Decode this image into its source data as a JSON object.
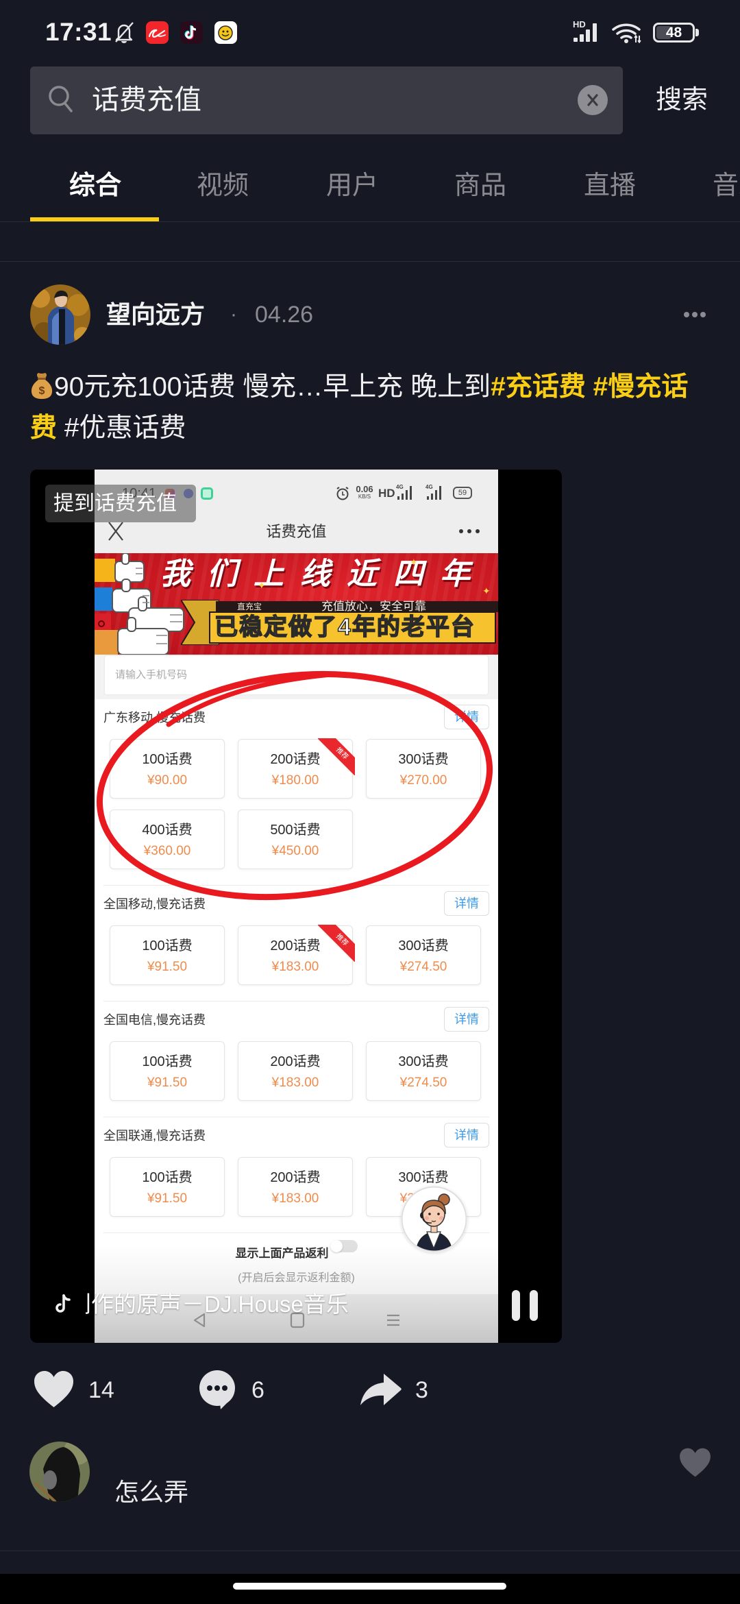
{
  "status_bar": {
    "time": "17:31",
    "network_badge": "HD",
    "battery": "48",
    "battery_percent": 48,
    "notification_icons": [
      "bell-off",
      "alibaba-app",
      "douyin-app",
      "smiley-app"
    ]
  },
  "search": {
    "query": "话费充值",
    "submit_label": "搜索"
  },
  "tabs": [
    {
      "label": "综合",
      "active": true
    },
    {
      "label": "视频",
      "active": false
    },
    {
      "label": "用户",
      "active": false
    },
    {
      "label": "商品",
      "active": false
    },
    {
      "label": "直播",
      "active": false
    },
    {
      "label": "音乐",
      "active": false
    }
  ],
  "post": {
    "author": "望向远方",
    "separator": "·",
    "date": "04.26",
    "caption": {
      "emoji": "money-bag",
      "text": "90元充100话费 慢充…早上充 晚上到",
      "hashtags": [
        {
          "label": "#充话费",
          "highlighted": true
        },
        {
          "label": "#慢充话费",
          "highlighted": true
        },
        {
          "label": "#优惠话费",
          "highlighted": false
        }
      ]
    },
    "video": {
      "tag_label": "提到话费充值",
      "music": "创作的原声－DJ.House音乐",
      "state": "playing",
      "screen": {
        "status_time": "10:41",
        "status_speed": "0.06",
        "status_speed_unit": "KB/S",
        "status_hd": "HD",
        "status_net": "4G",
        "status_battery": "59",
        "title": "话费充值",
        "banner": {
          "headline": "我们上线近四年",
          "brand": "直充宝",
          "slogan": "充值放心，安全可靠",
          "tagline": "已稳定做了4年的老平台"
        },
        "phone_placeholder": "请输入手机号码",
        "detail_label": "详情",
        "sections": [
          {
            "title": "广东移动,慢充话费",
            "items": [
              {
                "name": "100话费",
                "price": "¥90.00"
              },
              {
                "name": "200话费",
                "price": "¥180.00",
                "badge": "推荐"
              },
              {
                "name": "300话费",
                "price": "¥270.00"
              },
              {
                "name": "400话费",
                "price": "¥360.00"
              },
              {
                "name": "500话费",
                "price": "¥450.00"
              }
            ]
          },
          {
            "title": "全国移动,慢充话费",
            "items": [
              {
                "name": "100话费",
                "price": "¥91.50"
              },
              {
                "name": "200话费",
                "price": "¥183.00",
                "badge": "推荐"
              },
              {
                "name": "300话费",
                "price": "¥274.50"
              }
            ]
          },
          {
            "title": "全国电信,慢充话费",
            "items": [
              {
                "name": "100话费",
                "price": "¥91.50"
              },
              {
                "name": "200话费",
                "price": "¥183.00"
              },
              {
                "name": "300话费",
                "price": "¥274.50"
              }
            ]
          },
          {
            "title": "全国联通,慢充话费",
            "items": [
              {
                "name": "100话费",
                "price": "¥91.50"
              },
              {
                "name": "200话费",
                "price": "¥183.00"
              },
              {
                "name": "300话费",
                "price": "¥274.50"
              }
            ]
          }
        ],
        "rebate_toggle_label": "显示上面产品返利",
        "rebate_toggle_on": false,
        "rebate_hint": "(开启后会显示返利金额)"
      }
    },
    "stats": {
      "likes": "14",
      "comments": "6",
      "shares": "3"
    }
  },
  "comments": [
    {
      "text": "怎么弄"
    }
  ],
  "theme": {
    "background": "#161823",
    "accent": "#FACE15",
    "search_bg": "#393A44",
    "muted_text": "#8A8B91",
    "price_orange": "#F08B4C",
    "detail_blue": "#3D9AE8",
    "highlight_red": "#E81A1F"
  }
}
